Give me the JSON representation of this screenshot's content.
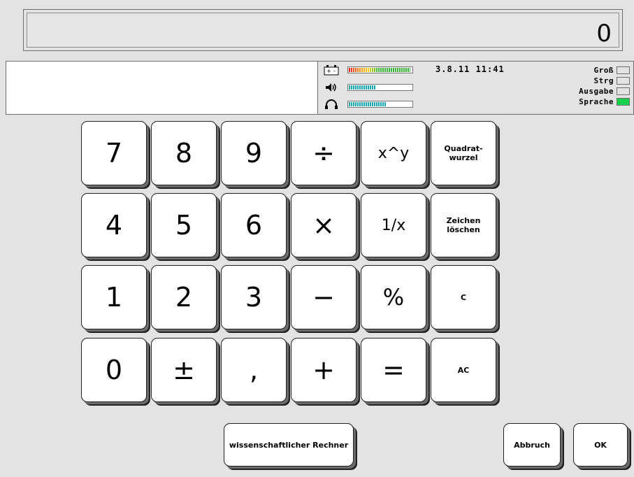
{
  "display": {
    "value": "0"
  },
  "status": {
    "message": "",
    "datetime": "3.8.11 11:41",
    "battery_level": 0.98,
    "volume_level": 0.45,
    "headphone_level": 0.6,
    "flags": [
      {
        "label": "Groß",
        "active": false
      },
      {
        "label": "Strg",
        "active": false
      },
      {
        "label": "Ausgabe",
        "active": false
      },
      {
        "label": "Sprache",
        "active": true
      }
    ],
    "active_color": "#17d24a"
  },
  "keys": {
    "r1": [
      "7",
      "8",
      "9",
      "÷",
      "x^y",
      "Quadrat-\nwurzel"
    ],
    "r2": [
      "4",
      "5",
      "6",
      "×",
      "1/x",
      "Zeichen\nlöschen"
    ],
    "r3": [
      "1",
      "2",
      "3",
      "−",
      "%",
      "C"
    ],
    "r4": [
      "0",
      "±",
      ",",
      "+",
      "=",
      "AC"
    ]
  },
  "bottom": {
    "scientific": "wissenschaftlicher Rechner",
    "cancel": "Abbruch",
    "ok": "OK"
  }
}
